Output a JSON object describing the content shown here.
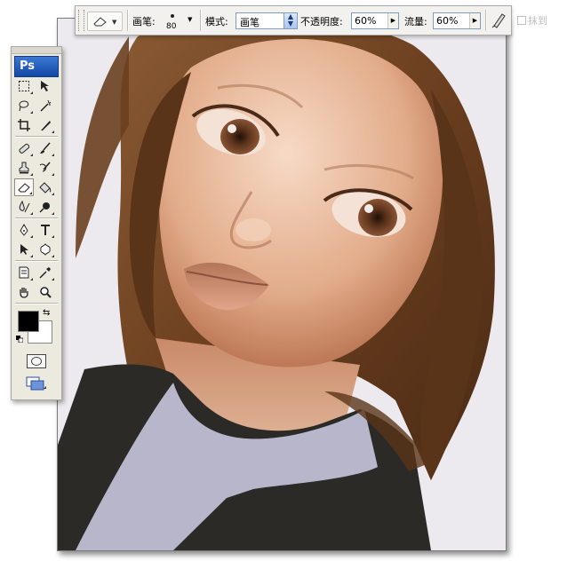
{
  "options_bar": {
    "brush_label": "画笔:",
    "brush_size": "80",
    "mode_label": "模式:",
    "mode_value": "画笔",
    "opacity_label": "不透明度:",
    "opacity_value": "60%",
    "flow_label": "流量:",
    "flow_value": "60%",
    "extra_label": "抹到"
  },
  "toolbox": {
    "logo": "Ps",
    "tools": [
      "marquee-tool",
      "move-tool",
      "lasso-tool",
      "magic-wand-tool",
      "crop-tool",
      "slice-tool",
      "healing-brush-tool",
      "brush-tool",
      "clone-stamp-tool",
      "history-brush-tool",
      "eraser-tool",
      "paint-bucket-tool",
      "blur-tool",
      "dodge-tool",
      "pen-tool",
      "type-tool",
      "path-selection-tool",
      "custom-shape-tool",
      "notes-tool",
      "eyedropper-tool",
      "hand-tool",
      "zoom-tool"
    ],
    "active_tool": "eraser-tool",
    "foreground_color": "#000000",
    "background_color": "#ffffff"
  },
  "colors": {
    "hair": "#6b3f1f",
    "skin": "#e6b999",
    "shirt": "#2b2a26",
    "collar": "#b7b6ca",
    "canvas_bg": "#eceaee"
  }
}
